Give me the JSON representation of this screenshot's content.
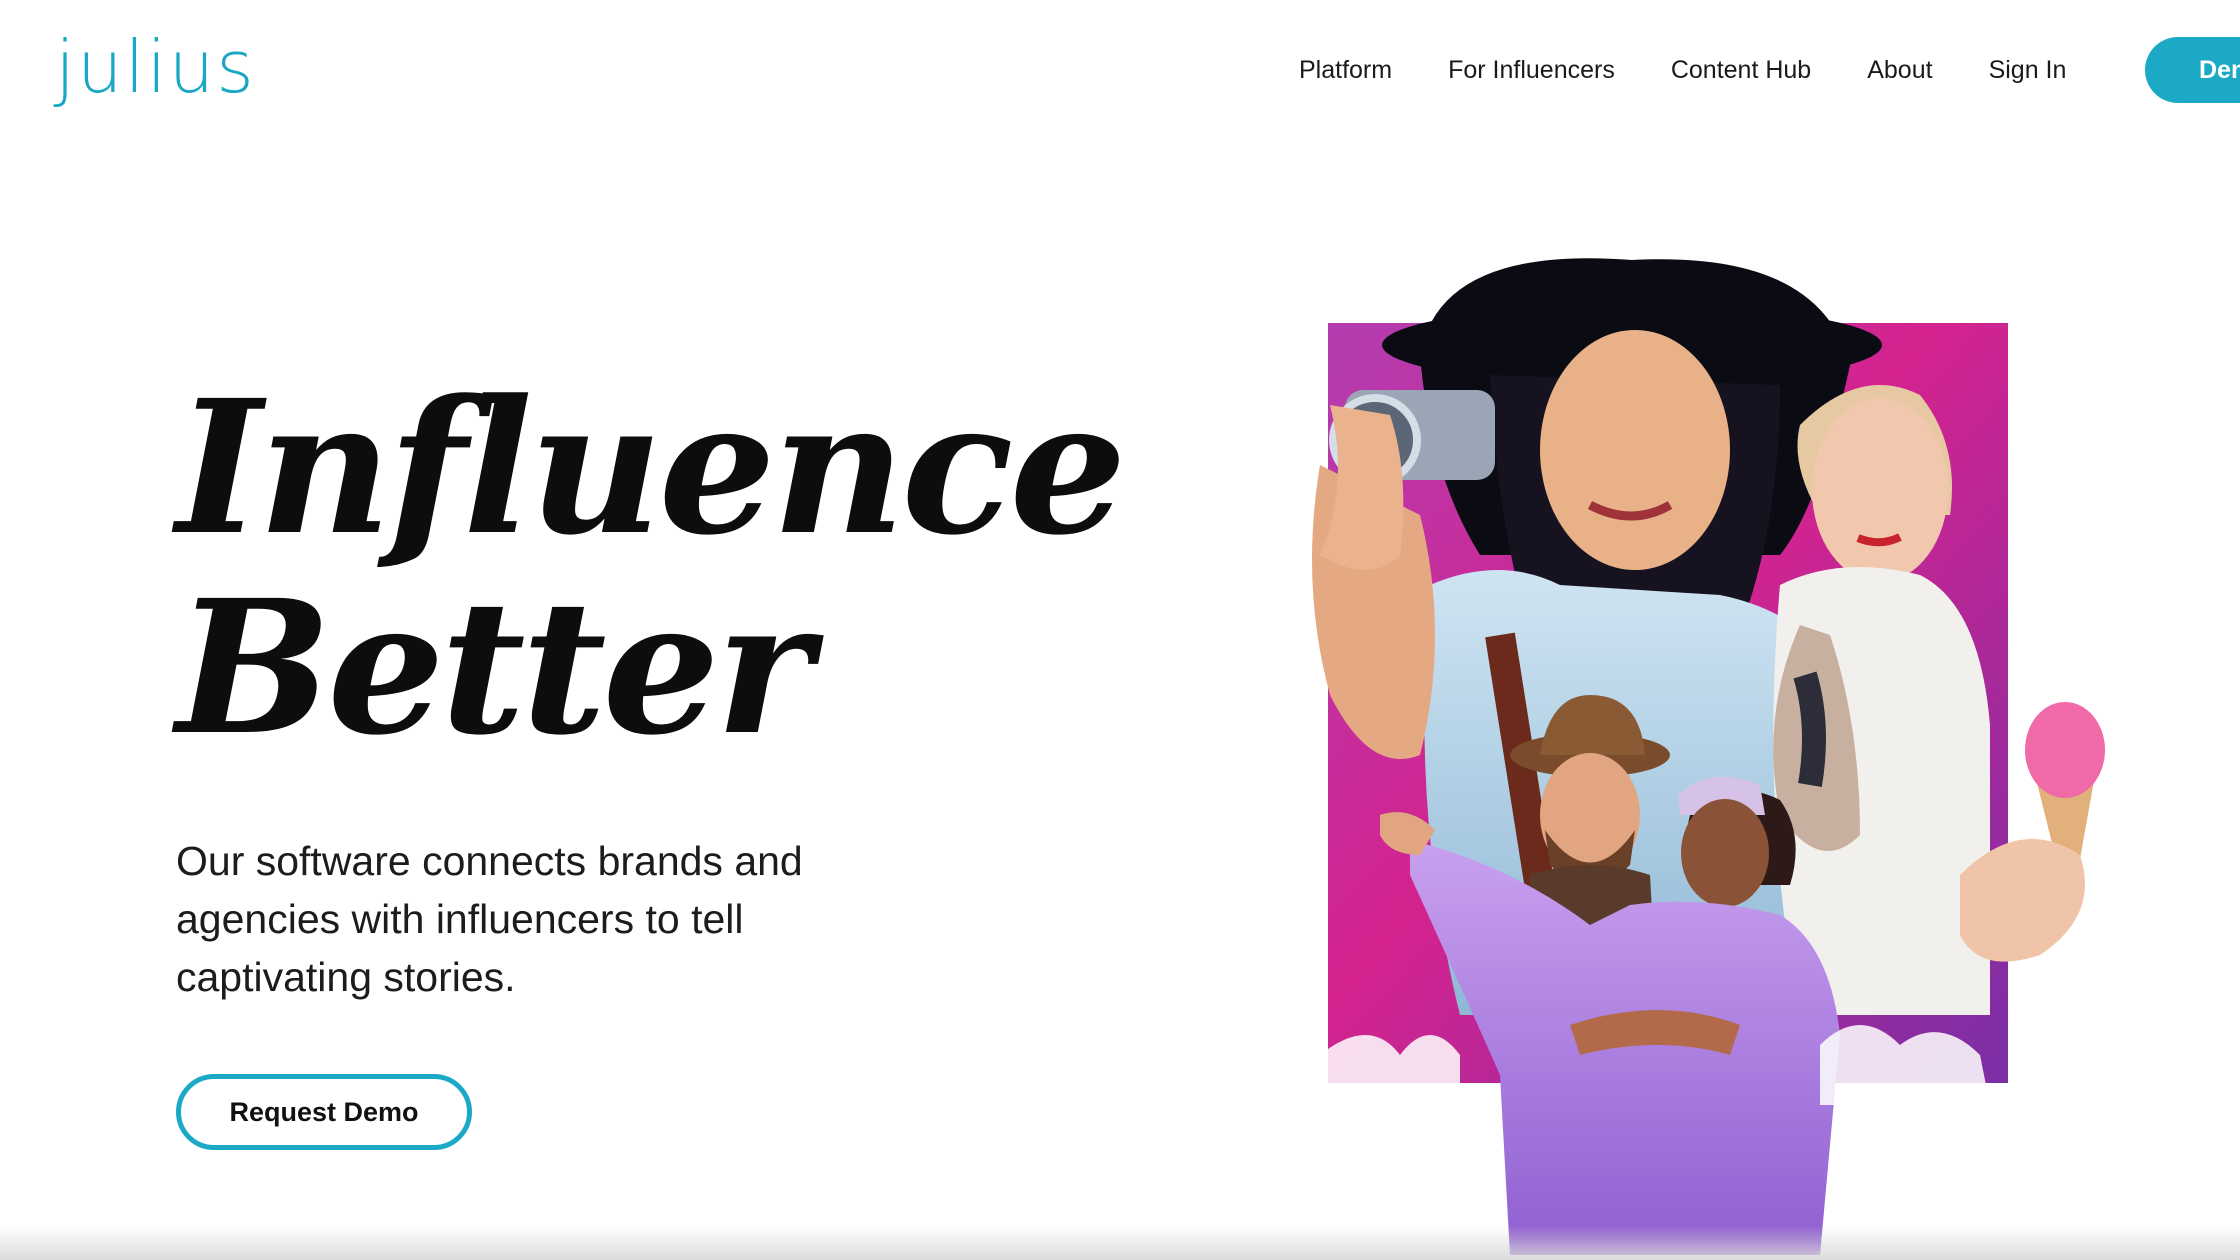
{
  "header": {
    "logo_text": "julius",
    "nav": [
      {
        "label": "Platform"
      },
      {
        "label": "For Influencers"
      },
      {
        "label": "Content Hub"
      },
      {
        "label": "About"
      },
      {
        "label": "Sign In"
      }
    ],
    "cta_label": "Demo"
  },
  "hero": {
    "title_line1": "Influence",
    "title_line2": "Better",
    "subtitle": "Our software connects brands and agencies with influencers to tell captivating stories.",
    "button_label": "Request Demo"
  },
  "colors": {
    "brand_teal": "#1ba9c6",
    "magenta": "#d4238f",
    "purple": "#8a3bb8"
  }
}
